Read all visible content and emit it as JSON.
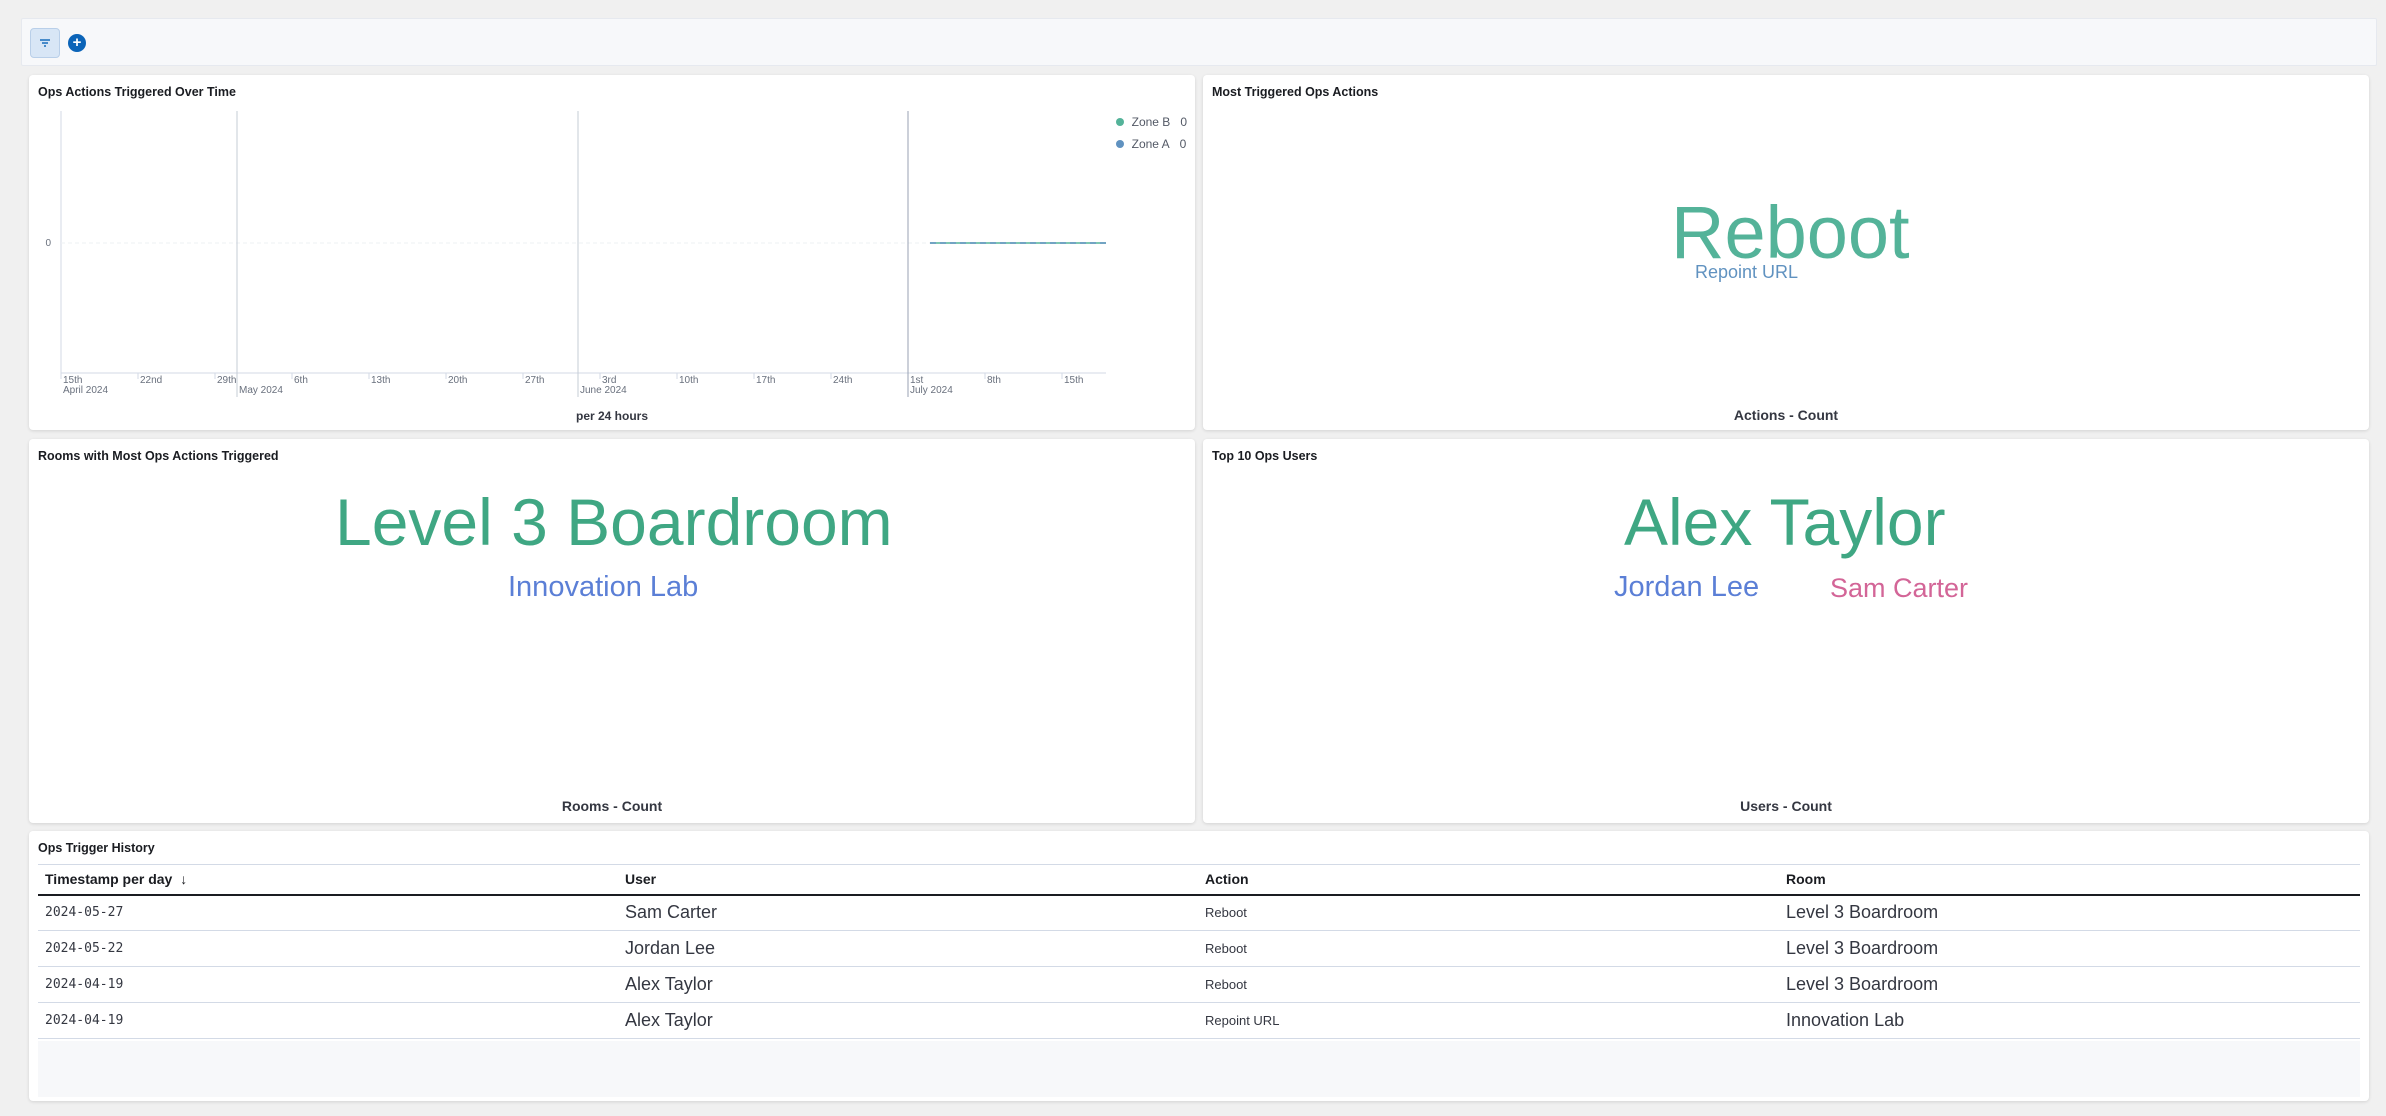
{
  "toolbar": {
    "filter_icon": "filter-icon",
    "add_icon": "plus-circle-icon",
    "add_symbol": "+"
  },
  "panels": {
    "time": {
      "title": "Ops Actions Triggered Over Time",
      "y_tick": "0",
      "x_ticks": [
        "15th",
        "22nd",
        "29th",
        "6th",
        "13th",
        "20th",
        "27th",
        "3rd",
        "10th",
        "17th",
        "24th",
        "1st",
        "8th",
        "15th"
      ],
      "month_labels": [
        "April 2024",
        "May 2024",
        "June 2024",
        "July 2024"
      ],
      "x_axis_label": "per 24 hours",
      "legend": [
        {
          "name": "Zone B",
          "value": "0",
          "color": "#54b399"
        },
        {
          "name": "Zone A",
          "value": "0",
          "color": "#6092c0"
        }
      ]
    },
    "actions": {
      "title": "Most Triggered Ops Actions",
      "words": [
        {
          "text": "Reboot",
          "color": "#54b399"
        },
        {
          "text": "Repoint URL",
          "color": "#6092c0"
        }
      ],
      "footer": "Actions - Count"
    },
    "rooms": {
      "title": "Rooms with Most Ops Actions Triggered",
      "words": [
        {
          "text": "Level 3 Boardroom",
          "color": "#3fa783"
        },
        {
          "text": "Innovation Lab",
          "color": "#5b7fd6"
        }
      ],
      "footer": "Rooms - Count"
    },
    "users": {
      "title": "Top 10 Ops Users",
      "words": [
        {
          "text": "Alex Taylor",
          "color": "#3fa783"
        },
        {
          "text": "Jordan Lee",
          "color": "#5b7fd6"
        },
        {
          "text": "Sam Carter",
          "color": "#d36597"
        }
      ],
      "footer": "Users - Count"
    },
    "history": {
      "title": "Ops Trigger History",
      "columns": [
        "Timestamp per day",
        "User",
        "Action",
        "Room"
      ],
      "sort_icon": "↓",
      "rows": [
        [
          "2024-05-27",
          "Sam Carter",
          "Reboot",
          "Level 3 Boardroom"
        ],
        [
          "2024-05-22",
          "Jordan Lee",
          "Reboot",
          "Level 3 Boardroom"
        ],
        [
          "2024-04-19",
          "Alex Taylor",
          "Reboot",
          "Level 3 Boardroom"
        ],
        [
          "2024-04-19",
          "Alex Taylor",
          "Repoint URL",
          "Innovation Lab"
        ]
      ]
    }
  },
  "chart_data": {
    "type": "line",
    "title": "Ops Actions Triggered Over Time",
    "xlabel": "per 24 hours",
    "ylabel": "",
    "x_range": [
      "2024-04-15",
      "2024-07-19"
    ],
    "series": [
      {
        "name": "Zone B",
        "color": "#54b399",
        "x": [
          "2024-07-03",
          "2024-07-19"
        ],
        "values": [
          0,
          0
        ]
      },
      {
        "name": "Zone A",
        "color": "#6092c0",
        "x": [
          "2024-07-03",
          "2024-07-19"
        ],
        "values": [
          0,
          0
        ]
      }
    ],
    "legend": "top-right",
    "grid": true
  }
}
